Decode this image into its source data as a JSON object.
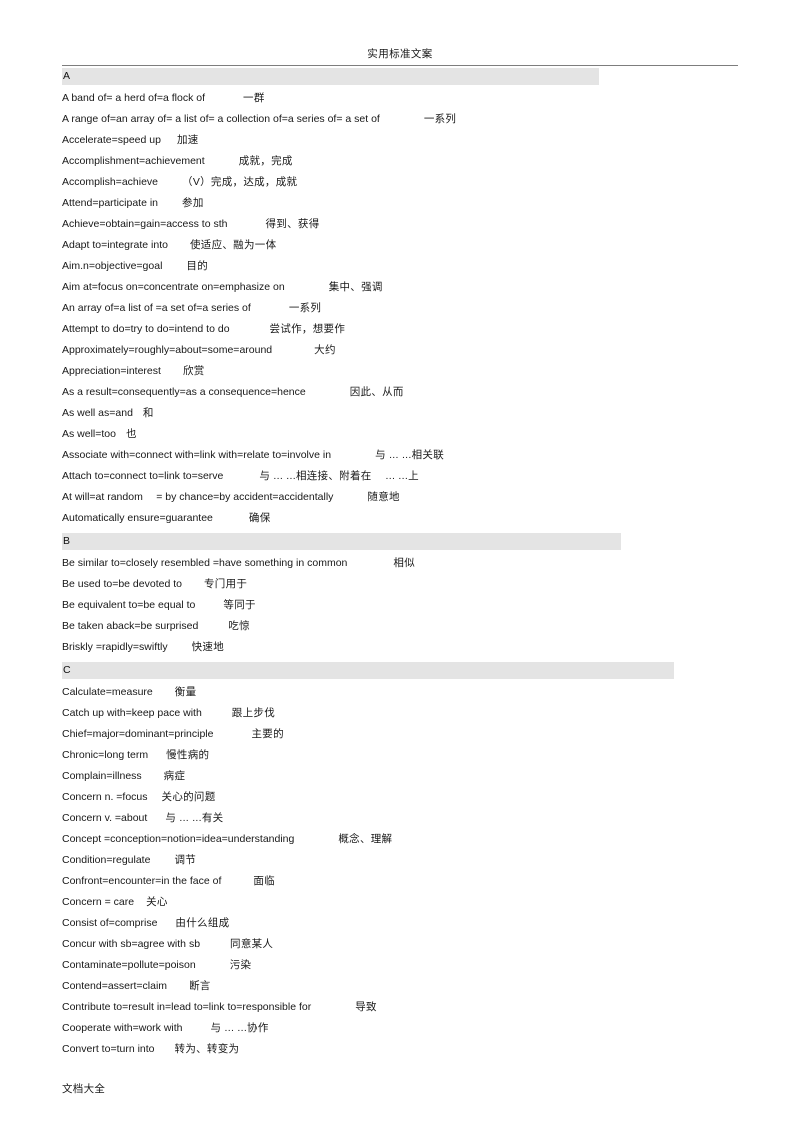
{
  "document": {
    "header_title": "实用标准文案",
    "footer_text": "文档大全"
  },
  "sections": [
    {
      "letter": "A",
      "entries": [
        {
          "en": "A band of= a herd of=a flock of",
          "gap": 38,
          "cn": "一群"
        },
        {
          "en": "A range of=an array of= a list of= a collection of=a series of= a set of",
          "gap": 44,
          "cn": "一系列"
        },
        {
          "en": "Accelerate=speed up",
          "gap": 16,
          "cn": "加速"
        },
        {
          "en": "Accomplishment=achievement",
          "gap": 34,
          "cn": "成就，完成"
        },
        {
          "en": "Accomplish=achieve",
          "gap": 24,
          "cn": "（V）完成，达成，成就"
        },
        {
          "en": "Attend=participate in",
          "gap": 24,
          "cn": "参加"
        },
        {
          "en": "Achieve=obtain=gain=access to sth",
          "gap": 38,
          "cn": "得到、获得"
        },
        {
          "en": "Adapt to=integrate into",
          "gap": 22,
          "cn": "使适应、融为一体"
        },
        {
          "en": "Aim.n=objective=goal",
          "gap": 24,
          "cn": "目的"
        },
        {
          "en": "Aim at=focus on=concentrate on=emphasize on",
          "gap": 44,
          "cn": "集中、强调"
        },
        {
          "en": "An array of=a list of =a set of=a series of",
          "gap": 38,
          "cn": "一系列"
        },
        {
          "en": "Attempt to do=try to do=intend to do",
          "gap": 40,
          "cn": "尝试作，想要作"
        },
        {
          "en": "Approximately=roughly=about=some=around",
          "gap": 42,
          "cn": "大约"
        },
        {
          "en": "Appreciation=interest",
          "gap": 22,
          "cn": "欣赏"
        },
        {
          "en": "As a result=consequently=as a consequence=hence",
          "gap": 44,
          "cn": "因此、从而"
        },
        {
          "en": "As well as=and",
          "gap": 10,
          "cn": "和"
        },
        {
          "en": "As well=too",
          "gap": 10,
          "cn": "也"
        },
        {
          "en": "Associate with=connect with=link with=relate to=involve in",
          "gap": 44,
          "cn": "与 ... ...相关联"
        },
        {
          "en": "Attach to=connect to=link to=serve",
          "gap": 36,
          "cn": "与 ... ...相连接、附着在　 ... ...上"
        },
        {
          "en": "At will=at random　 = by chance=by accident=accidentally",
          "gap": 34,
          "cn": "随意地"
        },
        {
          "en": "Automatically ensure=guarantee",
          "gap": 36,
          "cn": "确保"
        }
      ]
    },
    {
      "letter": "B",
      "entries": [
        {
          "en": "Be similar to=closely resembled =have something in common",
          "gap": 46,
          "cn": "相似"
        },
        {
          "en": "Be used to=be devoted to",
          "gap": 22,
          "cn": "专门用于"
        },
        {
          "en": "Be equivalent to=be equal to",
          "gap": 28,
          "cn": "等同于"
        },
        {
          "en": "Be taken aback=be surprised",
          "gap": 30,
          "cn": "吃惊"
        },
        {
          "en": "Briskly =rapidly=swiftly",
          "gap": 24,
          "cn": "快速地"
        }
      ]
    },
    {
      "letter": "C",
      "entries": [
        {
          "en": "Calculate=measure",
          "gap": 22,
          "cn": "衡量"
        },
        {
          "en": "Catch up with=keep pace with",
          "gap": 30,
          "cn": "跟上步伐"
        },
        {
          "en": "Chief=major=dominant=principle",
          "gap": 38,
          "cn": "主要的"
        },
        {
          "en": "Chronic=long term",
          "gap": 18,
          "cn": "慢性病的"
        },
        {
          "en": "Complain=illness",
          "gap": 22,
          "cn": "病症"
        },
        {
          "en": "Concern n. =focus",
          "gap": 14,
          "cn": "关心的问题"
        },
        {
          "en": "Concern v. =about",
          "gap": 18,
          "cn": "与 ... ...有关"
        },
        {
          "en": "Concept =conception=notion=idea=understanding",
          "gap": 44,
          "cn": "概念、理解"
        },
        {
          "en": "Condition=regulate",
          "gap": 24,
          "cn": "调节"
        },
        {
          "en": "Confront=encounter=in the face of",
          "gap": 32,
          "cn": "面临"
        },
        {
          "en": "Concern = care",
          "gap": 12,
          "cn": "关心"
        },
        {
          "en": "Consist of=comprise",
          "gap": 18,
          "cn": "由什么组成"
        },
        {
          "en": "Concur with sb=agree with sb",
          "gap": 30,
          "cn": "同意某人"
        },
        {
          "en": "Contaminate=pollute=poison",
          "gap": 34,
          "cn": "污染"
        },
        {
          "en": "Contend=assert=claim",
          "gap": 22,
          "cn": "断言"
        },
        {
          "en": "Contribute to=result in=lead to=link to=responsible for",
          "gap": 44,
          "cn": "导致"
        },
        {
          "en": "Cooperate with=work with",
          "gap": 28,
          "cn": "与 ... ...协作"
        },
        {
          "en": "Convert to=turn into",
          "gap": 20,
          "cn": "转为、转变为"
        }
      ]
    }
  ]
}
